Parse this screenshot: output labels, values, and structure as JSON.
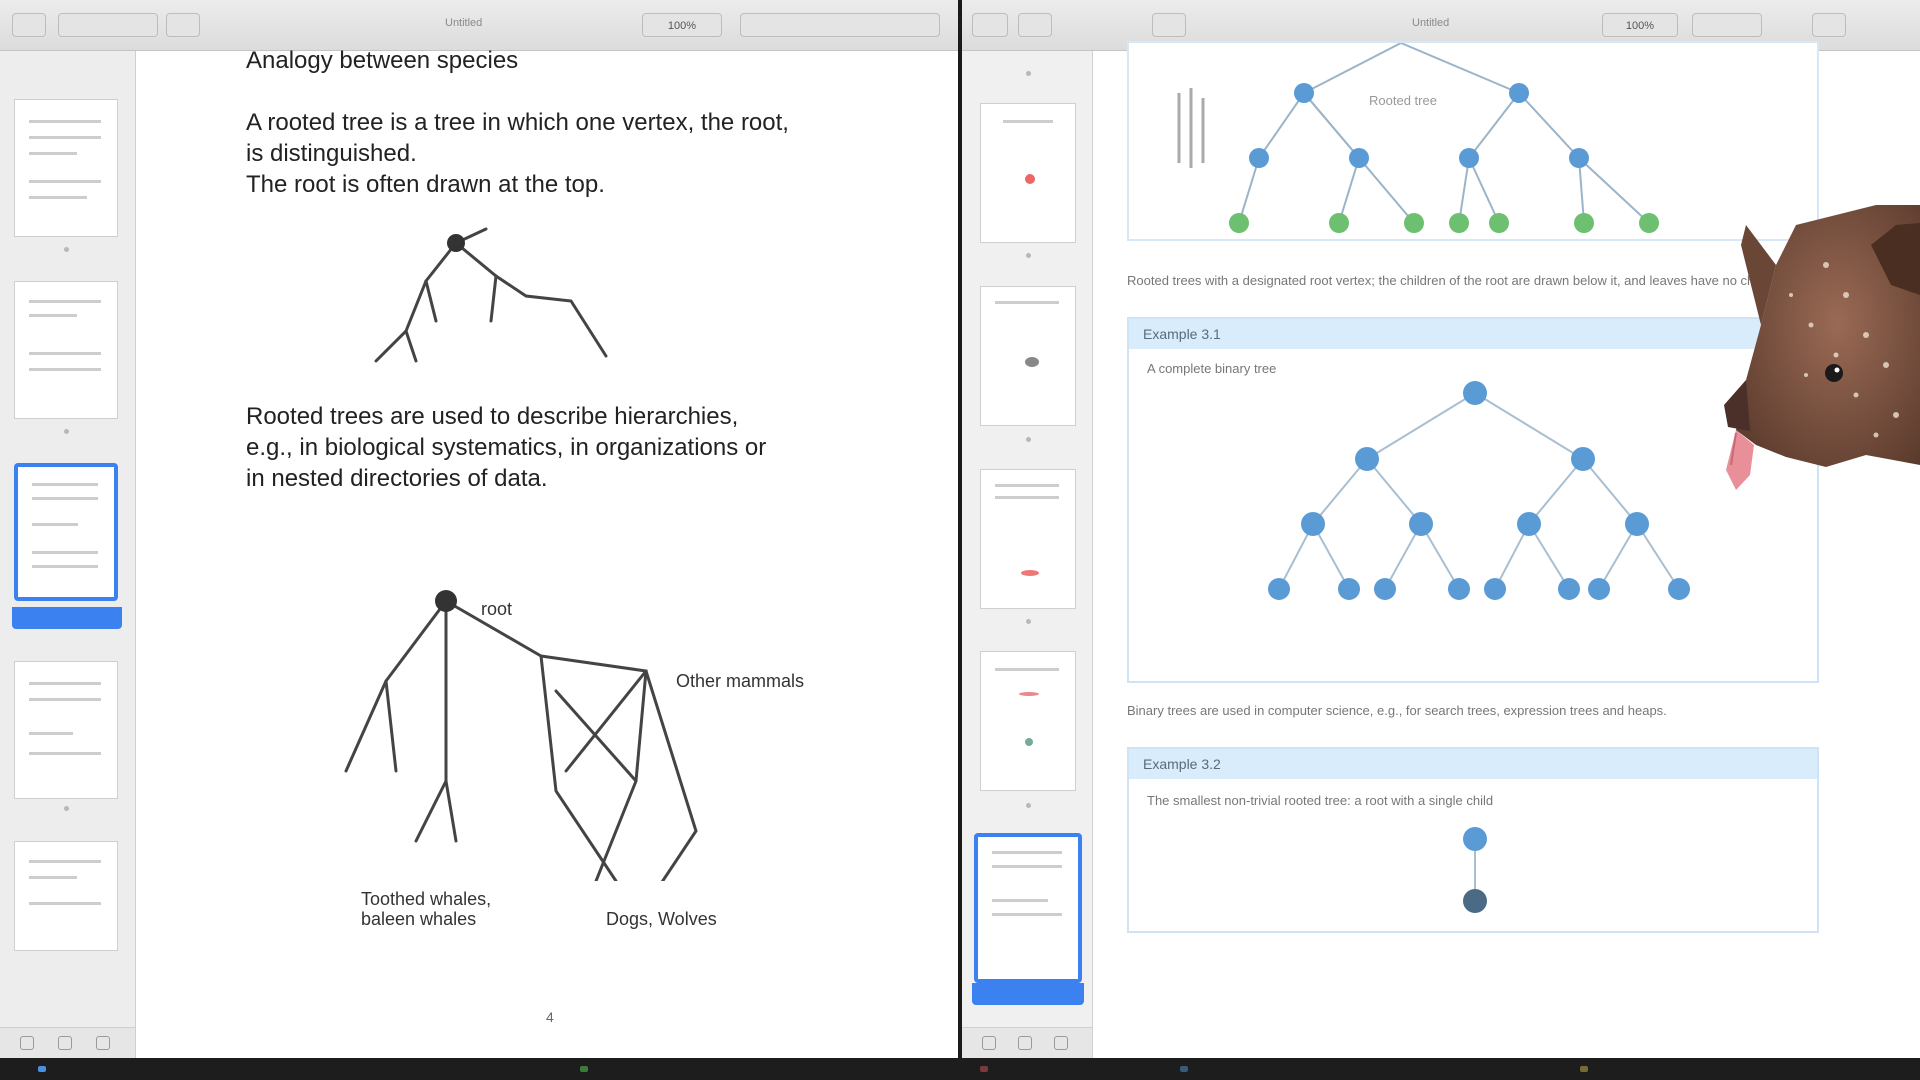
{
  "left_window": {
    "toolbar_title": "Untitled",
    "zoom_label": "100%",
    "page_body": {
      "heading_fragment": "Analogy between species",
      "paragraph_1": "A rooted tree is a tree in which one vertex, the root,\nis distinguished.\nThe root is often drawn at the top.",
      "paragraph_2": "Rooted trees are used to describe hierarchies,\ne.g., in biological systematics, in organizations or\nin nested directories of data.",
      "diagram_labels": {
        "root": "root",
        "other_mammals": "Other mammals",
        "whales": "whales",
        "ungulates": "Dogs, Wolves",
        "toothed": "Toothed whales, baleen whales"
      },
      "page_number": "4"
    }
  },
  "right_window": {
    "toolbar_title": "Untitled",
    "zoom_label": "100%",
    "page_body": {
      "figure_label": "Rooted tree",
      "caption_1": "Rooted trees with a designated root vertex; the children of the root are drawn below it, and leaves have no children.",
      "example_1": {
        "header": "Example 3.1",
        "subtitle": "A complete binary tree"
      },
      "caption_2": "Binary trees are used in computer science, e.g., for search trees, expression trees and heaps.",
      "example_2": {
        "header": "Example 3.2",
        "subtitle": "The smallest non-trivial rooted tree: a root with a single child"
      }
    }
  },
  "colors": {
    "accent_blue": "#3b82f0",
    "node_blue": "#5b9bd5",
    "leaf_green": "#6cc070",
    "box_header": "#d8ecfb"
  },
  "icons": [
    "sidebar-toggle-icon",
    "zoom-icon",
    "rotate-icon",
    "markup-icon",
    "search-icon",
    "share-icon"
  ]
}
